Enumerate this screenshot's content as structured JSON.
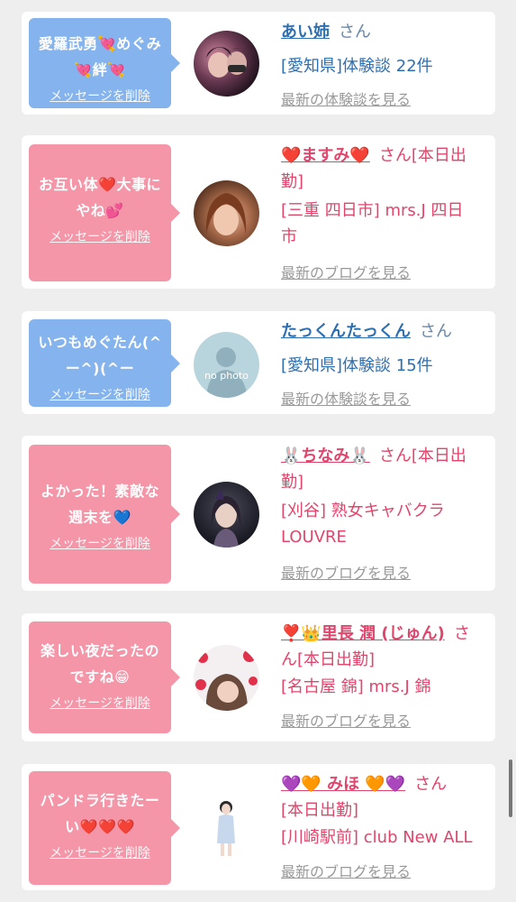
{
  "delete_label": "メッセージを削除",
  "cards": [
    {
      "message_line1": "愛羅武勇💘めぐみ",
      "message_line2": "💘絆💘",
      "name": "あい姉",
      "san": "さん",
      "detail_line1": "[愛知県]体験談 22件",
      "more": "最新の体験談を見る"
    },
    {
      "message_line1": "お互い体❤️大事に",
      "message_line2": "やね💕",
      "name": "❤️ますみ❤️",
      "san": "さん[本日出",
      "name_line2": "勤]",
      "detail_line1": "[三重 四日市] mrs.J 四日",
      "detail_line2": "市",
      "more": "最新のブログを見る"
    },
    {
      "message_line1": "いつもめぐたん(^",
      "message_line2": "ー^)(^ー",
      "name": "たっくんたっくん",
      "san": "さん",
      "detail_line1": "[愛知県]体験談 15件",
      "more": "最新の体験談を見る",
      "avatar_text": "no photo"
    },
    {
      "message_line1": "よかった！素敵な",
      "message_line2": "週末を💙",
      "name": "🐰ちなみ🐰",
      "san": "さん[本日出",
      "name_line2": "勤]",
      "detail_line1": "[刈谷] 熟女キャバクラ",
      "detail_line2": "LOUVRE",
      "more": "最新のブログを見る"
    },
    {
      "message_line1": "楽しい夜だったの",
      "message_line2": "ですね😁",
      "name": "❣️👑里長 潤 (じゅん)",
      "san": "さ",
      "name_line2": "ん[本日出勤]",
      "detail_line1": "[名古屋 錦] mrs.J 錦",
      "more": "最新のブログを見る"
    },
    {
      "message_line1": "パンドラ行きたー",
      "message_line2": "い❤️❤️❤️",
      "name": "💜🧡 みほ 🧡💜",
      "san": "さん",
      "name_line2": "[本日出勤]",
      "detail_line1": "[川崎駅前] club New ALL",
      "more": "最新のブログを見る"
    }
  ]
}
